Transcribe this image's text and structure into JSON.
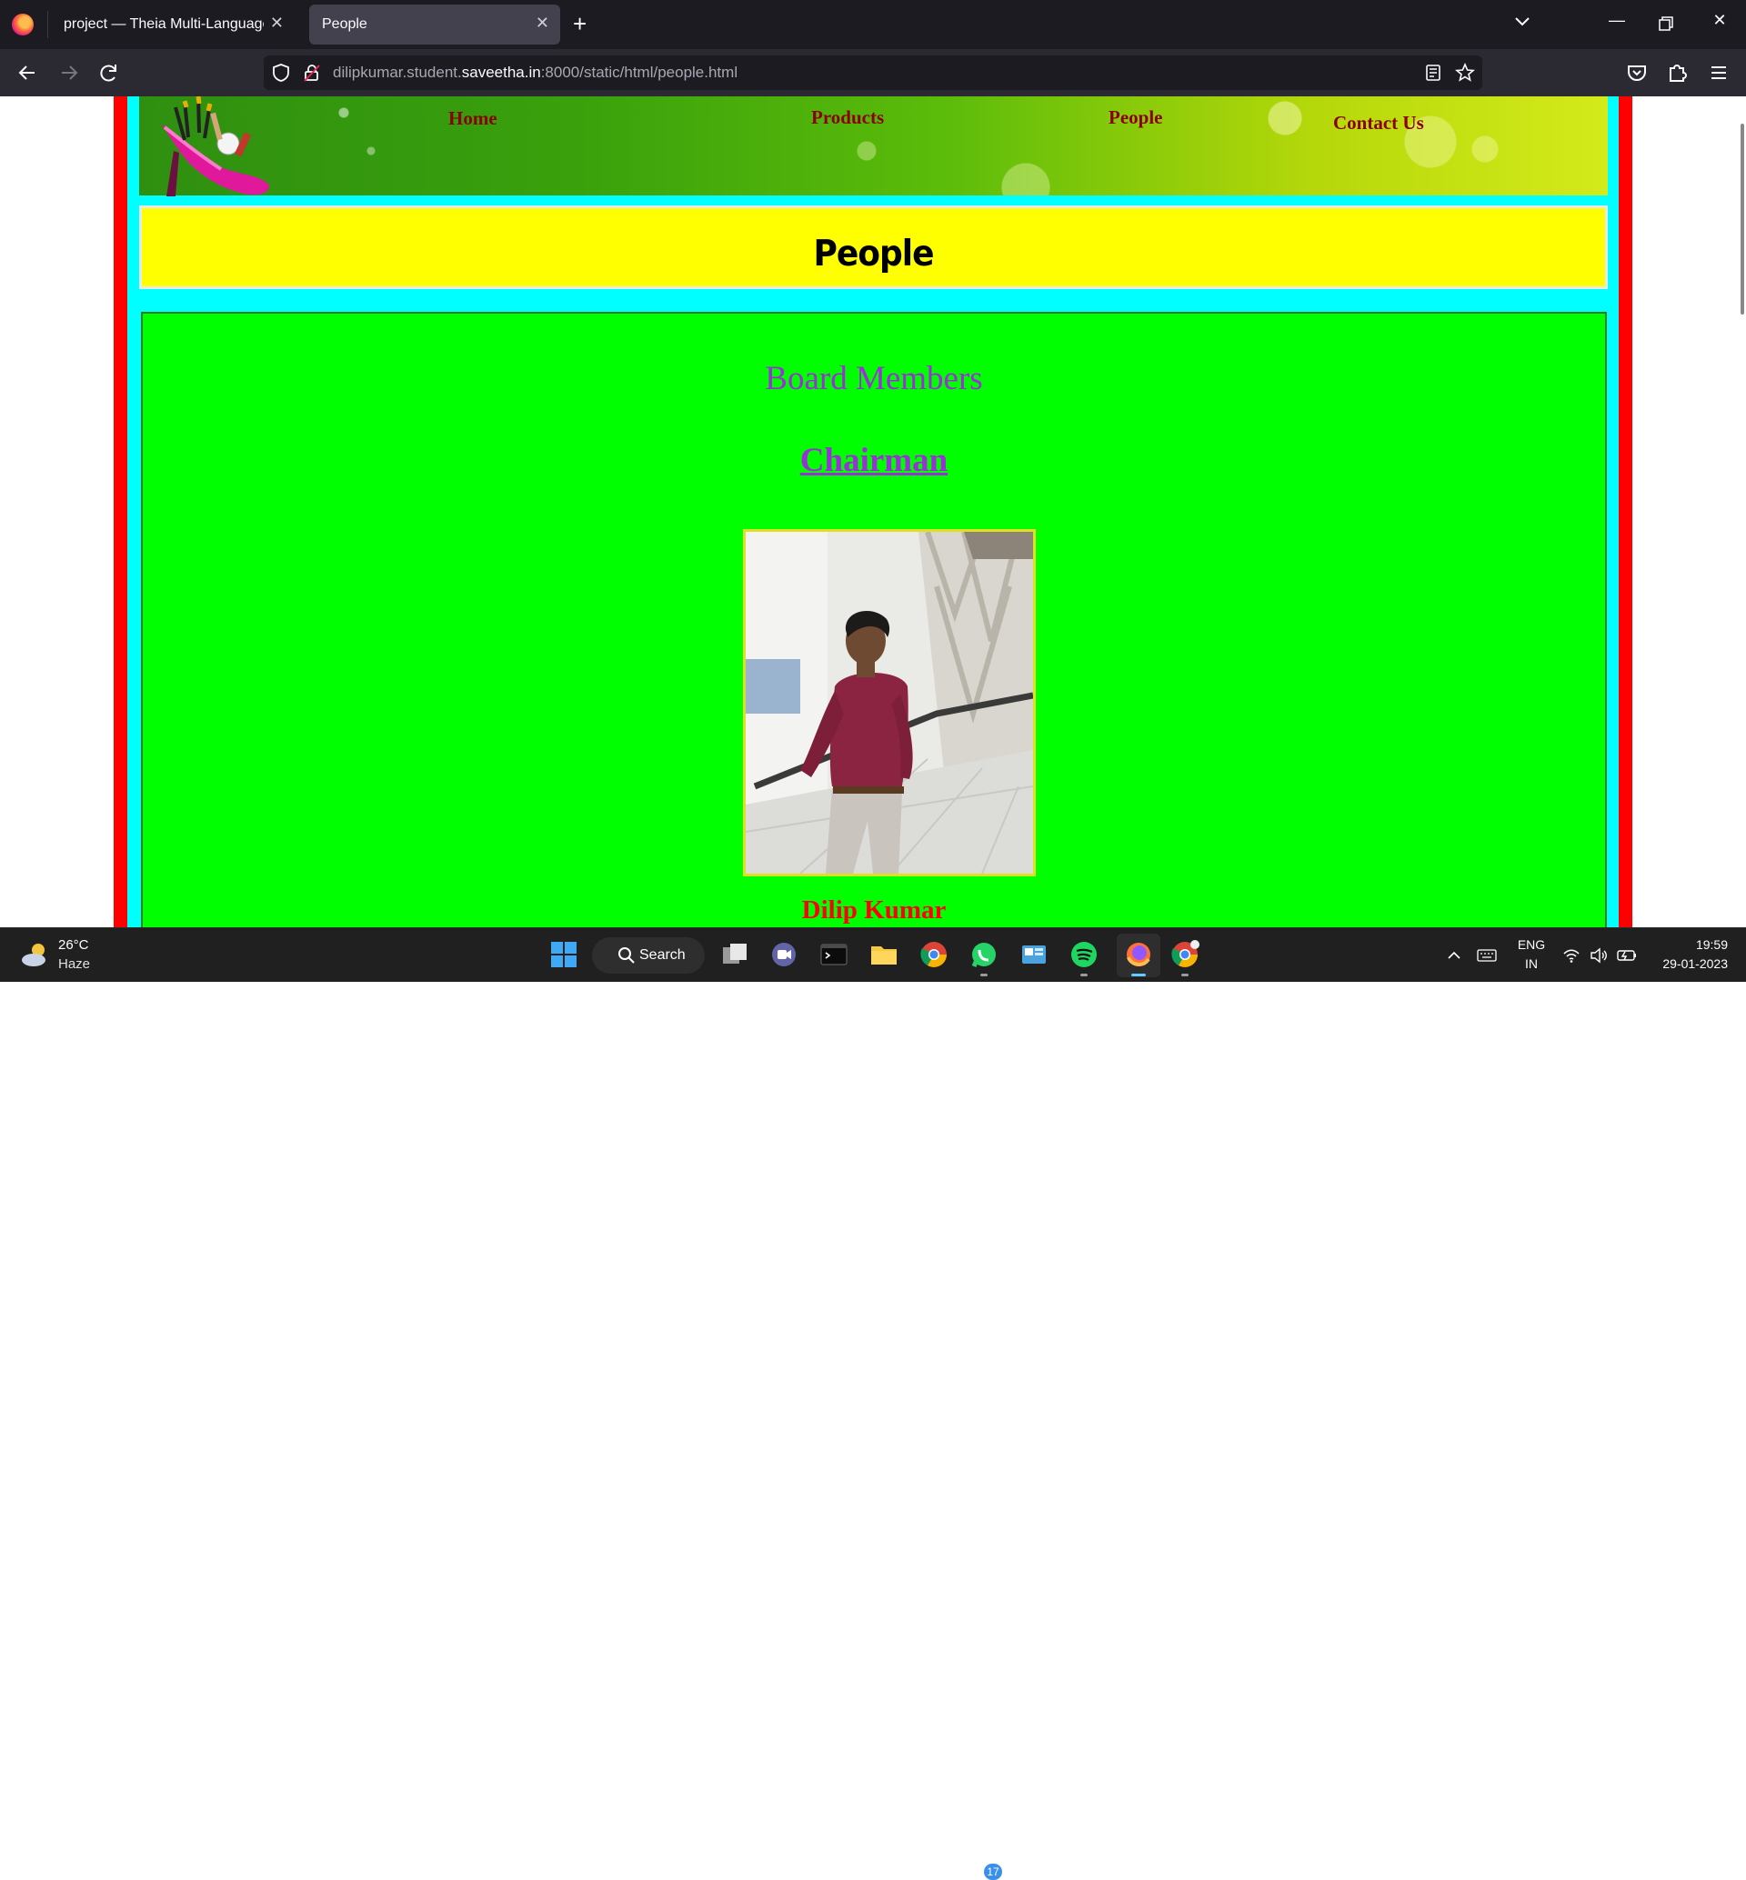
{
  "browser": {
    "tabs": [
      {
        "label": "project — Theia Multi-Language Ex",
        "active": false
      },
      {
        "label": "People",
        "active": true
      }
    ],
    "url": {
      "prefix": "dilipkumar.student.",
      "domain": "saveetha.in",
      "suffix": ":8000/static/html/people.html"
    }
  },
  "site": {
    "menu": {
      "home": "Home",
      "products": "Products",
      "people": "People",
      "contact": "Contact Us"
    },
    "page_title": "People",
    "section_heading": "Board Members",
    "role": "Chairman",
    "person_name": "Dilip Kumar",
    "colors": {
      "frame": "#ff0000",
      "inner": "#00ffff",
      "title_bg": "#ffff00",
      "content_bg": "#00ff00",
      "heading": "#9b30d9",
      "menu_text": "#8b0000",
      "name_text": "#ff0000"
    }
  },
  "taskbar": {
    "weather": {
      "temp": "26°C",
      "desc": "Haze"
    },
    "search_label": "Search",
    "whatsapp_badge": "17",
    "language": {
      "line1": "ENG",
      "line2": "IN"
    },
    "clock": {
      "time": "19:59",
      "date": "29-01-2023"
    },
    "icons": [
      "windows-start-icon",
      "search-icon",
      "task-view-icon",
      "teams-chat-icon",
      "terminal-icon",
      "file-explorer-icon",
      "chrome-icon",
      "whatsapp-icon",
      "control-panel-icon",
      "spotify-icon",
      "firefox-icon",
      "chrome-canary-icon"
    ]
  }
}
